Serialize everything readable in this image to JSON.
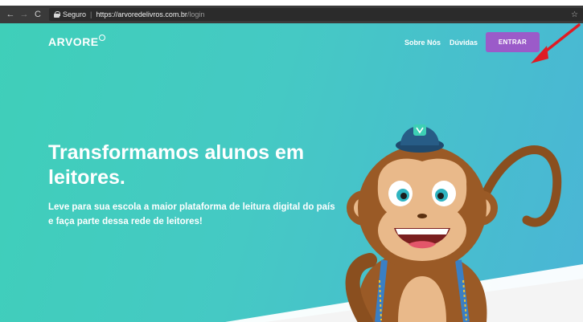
{
  "browser": {
    "back_glyph": "←",
    "forward_glyph": "→",
    "reload_glyph": "C",
    "secure_label": "Seguro",
    "separator": "|",
    "url_host": "https://arvoredelivros.com.br",
    "url_path": "/login",
    "star_glyph": "☆"
  },
  "header": {
    "logo_text": "ARVORE",
    "nav": {
      "about": "Sobre Nós",
      "faq": "Dúvidas"
    },
    "login_button": "ENTRAR"
  },
  "hero": {
    "headline": "Transformamos alunos em leitores.",
    "subline": "Leve para sua escola a maior plataforma de leitura digital do país e faça parte dessa rede de leitores!"
  },
  "colors": {
    "hero_start": "#3fcfb9",
    "hero_end": "#4ab5d6",
    "login_button": "#9b5bc9",
    "annotation_arrow": "#e01b24"
  },
  "icons": [
    "back-arrow-icon",
    "forward-arrow-icon",
    "reload-icon",
    "lock-icon",
    "bookmark-star-icon",
    "logo-mark-icon",
    "monkey-mascot",
    "annotation-arrow"
  ]
}
